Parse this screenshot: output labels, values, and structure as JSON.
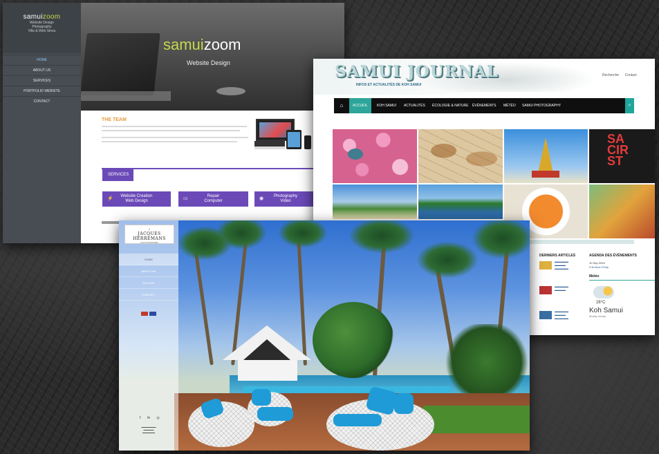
{
  "samuizoom": {
    "logo_first": "samui",
    "logo_second": "zoom",
    "tagline": [
      "Website Design",
      "Photography",
      "Villa & Web Sinou"
    ],
    "menu": [
      "HOME",
      "ABOUT US",
      "SERVICES",
      "PORTFOLIO WEBSITE",
      "CONTACT"
    ],
    "hero_title_first": "samui",
    "hero_title_second": "zoom",
    "hero_subtitle": "Website Design",
    "section_title": "THE TEAM",
    "services_label": "SERVICES",
    "services": [
      {
        "icon": "bolt-icon",
        "glyph": "⚡",
        "label": "Website Creation\nWeb Design"
      },
      {
        "icon": "laptop-icon",
        "glyph": "▭",
        "label": "Repair\nComputer"
      },
      {
        "icon": "camera-icon",
        "glyph": "◉",
        "label": "Photography\nVideo"
      }
    ],
    "colors": {
      "accent": "#6b4ab8",
      "logo_green": "#c8d84a",
      "sidebar": "#474d52"
    }
  },
  "journal": {
    "title": "SAMUI JOURNAL",
    "subtitle": "INFOS ET ACTUALITÉS DE KOH SAMUI",
    "top_links": [
      "Recherche",
      "Contact"
    ],
    "nav": [
      "ACCUEIL",
      "KOH SAMUI",
      "ACTUALITÉS",
      "ÉCOLOGIE & NATURE",
      "ÉVÈNEMENTS",
      "MÉTÉO",
      "SAMUI PHOTOGRAPHY"
    ],
    "recent_heading": "DERNIERS ARTICLES",
    "agenda_heading": "AGENDA DES ÉVÈNEMENTS",
    "agenda_date": "10 Sep 2015",
    "agenda_event": "Full Moon Party",
    "meteo_heading": "Météo",
    "temperature": "28°C",
    "city": "Koh Samui",
    "condition": "Mostly cloudy",
    "colors": {
      "accent": "#2ea59a",
      "nav": "#0f0f0f"
    }
  },
  "herremans": {
    "logo_top": "J",
    "logo_name": "JACQUES HERREMANS",
    "logo_sub": "PHOTOGRAPHER",
    "menu": [
      "HOME",
      "ABOUT ME",
      "GALLERY",
      "CONTACT"
    ],
    "social": "f ✉ ◎",
    "colors": {
      "cushion": "#1f9bd7",
      "sky": "#2f6fd0"
    }
  }
}
